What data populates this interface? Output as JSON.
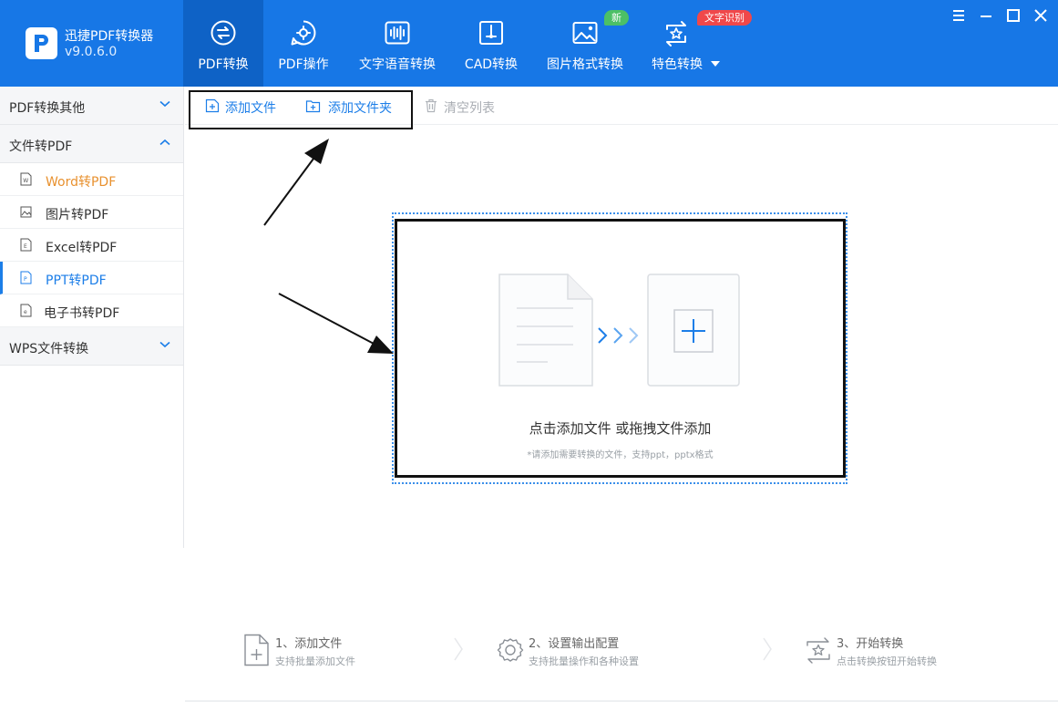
{
  "app": {
    "name": "迅捷PDF转换器",
    "version": "v9.0.6.0",
    "logo_icon": "pdf-p-logo-icon"
  },
  "colors": {
    "header_bg": "#1777e6",
    "active_tab_bg": "#0e62c6",
    "accent_blue": "#1c7ee8",
    "hover_orange": "#e8912f",
    "badge_green": "#4cc066",
    "badge_red": "#f0484a"
  },
  "nav": {
    "tabs": [
      {
        "label": "PDF转换",
        "icon": "swap-circle-icon",
        "active": true
      },
      {
        "label": "PDF操作",
        "icon": "gear-bubble-icon",
        "active": false
      },
      {
        "label": "文字语音转换",
        "icon": "audio-wave-icon",
        "active": false
      },
      {
        "label": "CAD转换",
        "icon": "cad-compass-icon",
        "active": false
      },
      {
        "label": "图片格式转换",
        "icon": "image-icon",
        "active": false
      },
      {
        "label": "特色转换",
        "icon": "star-cycle-icon",
        "active": false
      }
    ],
    "badges": {
      "new": "新",
      "ocr": "文字识别"
    },
    "more_icon": "caret-down-icon"
  },
  "window_controls": [
    "menu-icon",
    "minimize-icon",
    "maximize-icon",
    "close-icon"
  ],
  "sidebar": {
    "groups": [
      {
        "label": "PDF转换其他",
        "expanded": false
      },
      {
        "label": "文件转PDF",
        "expanded": true
      },
      {
        "label": "WPS文件转换",
        "expanded": false
      }
    ],
    "items": [
      {
        "label": "Word转PDF",
        "state": "hover",
        "icon": "word-file-icon"
      },
      {
        "label": "图片转PDF",
        "state": "normal",
        "icon": "image-file-icon"
      },
      {
        "label": "Excel转PDF",
        "state": "normal",
        "icon": "excel-file-icon"
      },
      {
        "label": "PPT转PDF",
        "state": "selected",
        "icon": "ppt-file-icon"
      },
      {
        "label": "电子书转PDF",
        "state": "normal",
        "icon": "ebook-file-icon"
      }
    ]
  },
  "toolbar": {
    "add_file": "添加文件",
    "add_folder": "添加文件夹",
    "clear_list": "清空列表"
  },
  "dropzone": {
    "title": "点击添加文件 或拖拽文件添加",
    "hint": "*请添加需要转换的文件，支持ppt，pptx格式"
  },
  "steps": [
    {
      "title": "1、添加文件",
      "sub": "支持批量添加文件",
      "icon": "add-file-icon"
    },
    {
      "title": "2、设置输出配置",
      "sub": "支持批量操作和各种设置",
      "icon": "settings-gear-icon"
    },
    {
      "title": "3、开始转换",
      "sub": "点击转换按钮开始转换",
      "icon": "convert-star-icon"
    }
  ]
}
